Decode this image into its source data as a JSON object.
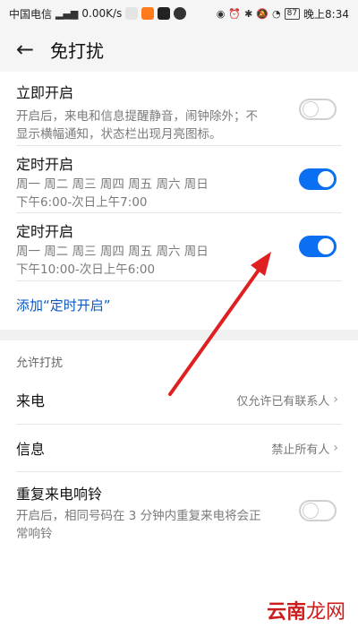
{
  "status_bar": {
    "carrier": "中国电信",
    "network": "4G",
    "speed": "0.00K/s",
    "battery": "87",
    "time": "晚上8:34"
  },
  "app_bar": {
    "title": "免打扰",
    "back_icon": "arrow-left-icon"
  },
  "items": {
    "immediate": {
      "title": "立即开启",
      "desc_line1": "开启后，来电和信息提醒静音，闹钟除外；不",
      "desc_line2": "显示横幅通知，状态栏出现月亮图标。",
      "enabled": false
    },
    "schedule1": {
      "title": "定时开启",
      "days": "周一 周二 周三 周四 周五 周六 周日",
      "time": "下午6:00-次日上午7:00",
      "enabled": true
    },
    "schedule2": {
      "title": "定时开启",
      "days": "周一 周二 周三 周四 周五 周六 周日",
      "time": "下午10:00-次日上午6:00",
      "enabled": true
    },
    "add_schedule": "添加“定时开启”"
  },
  "allow": {
    "section_title": "允许打扰",
    "calls": {
      "label": "来电",
      "value": "仅允许已有联系人"
    },
    "messages": {
      "label": "信息",
      "value": "禁止所有人"
    },
    "repeat": {
      "title": "重复来电响铃",
      "desc_line1": "开启后，相同号码在 3 分钟内重复来电将会正",
      "desc_line2": "常响铃",
      "enabled": false
    }
  },
  "watermark": {
    "text_a": "云南",
    "text_b": "龙网"
  },
  "colors": {
    "accent": "#0a6ff0",
    "link": "#0a59c4",
    "arrow": "#e02020"
  }
}
